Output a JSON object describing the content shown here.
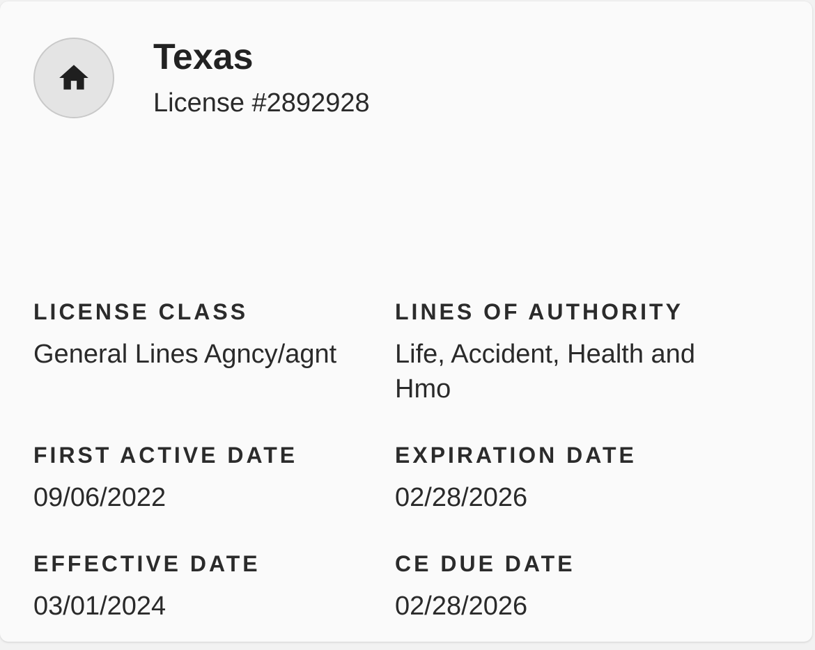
{
  "license": {
    "state": "Texas",
    "number": "License #2892928",
    "icon": "home-icon"
  },
  "fields": [
    {
      "label": "LICENSE CLASS",
      "value": "General Lines Agncy/agnt"
    },
    {
      "label": "LINES OF AUTHORITY",
      "value": "Life, Accident, Health and Hmo"
    },
    {
      "label": "FIRST ACTIVE DATE",
      "value": "09/06/2022"
    },
    {
      "label": "EXPIRATION DATE",
      "value": "02/28/2026"
    },
    {
      "label": "EFFECTIVE DATE",
      "value": "03/01/2024"
    },
    {
      "label": "CE DUE DATE",
      "value": "02/28/2026"
    }
  ],
  "colors": {
    "card_bg": "#fafafa",
    "avatar_bg": "#e4e4e4",
    "text": "#222222"
  }
}
